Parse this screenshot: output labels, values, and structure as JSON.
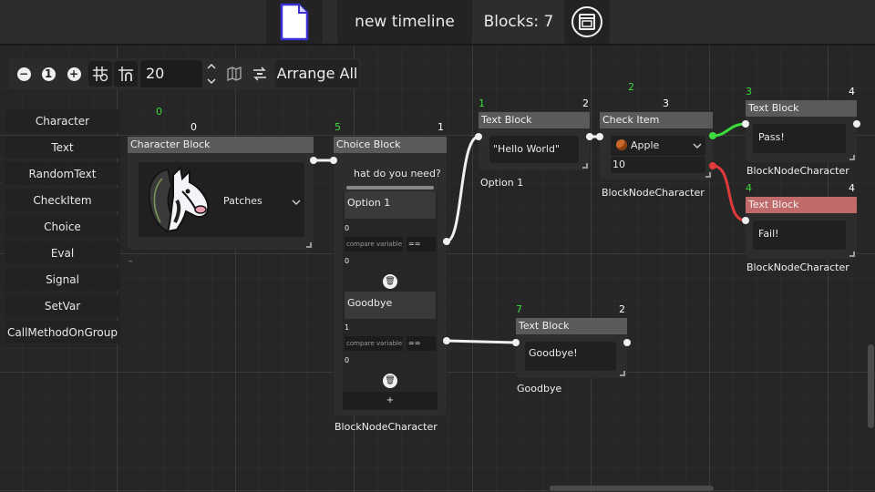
{
  "topbar": {
    "timeline_name": "new timeline",
    "blocks_count": "Blocks: 7",
    "file_icon": "document-icon",
    "menu_icon": "timeline-menu-icon"
  },
  "toolbar": {
    "zoom_out": "−",
    "zoom_reset": "1",
    "zoom_in": "+",
    "snap_value": "20",
    "arrange_all": "Arrange All"
  },
  "sidebar": {
    "items": [
      "Character",
      "Text",
      "RandomText",
      "CheckItem",
      "Choice",
      "Eval",
      "Signal",
      "SetVar",
      "CallMethodOnGroup"
    ]
  },
  "nodes": {
    "character": {
      "index": "0",
      "title": "Character Block",
      "character_name": "Patches"
    },
    "choice": {
      "index": "5",
      "out_count": "1",
      "title": "Choice Block",
      "prompt": "hat do you need?",
      "option1": {
        "label": "Option 1",
        "value": "0",
        "compare_placeholder": "compare variable",
        "operator": "==",
        "compare_value": "0"
      },
      "option2": {
        "label": "Goodbye",
        "value": "1",
        "compare_placeholder": "compare variable",
        "operator": "==",
        "compare_value": "0"
      },
      "add": "+",
      "footer": "BlockNodeCharacter"
    },
    "text1": {
      "index": "1",
      "out_count": "2",
      "title": "Text Block",
      "text": "\"Hello World\"",
      "footer": "Option 1"
    },
    "check": {
      "index": "2",
      "out_count": "3",
      "title": "Check Item",
      "item": "Apple",
      "quantity": "10",
      "footer": "BlockNodeCharacter"
    },
    "pass": {
      "index": "3",
      "out_count": "4",
      "title": "Text Block",
      "text": "Pass!",
      "footer": "BlockNodeCharacter"
    },
    "fail": {
      "index": "4",
      "out_count": "4",
      "title": "Text Block",
      "text": "Fail!",
      "footer": "BlockNodeCharacter"
    },
    "goodbye": {
      "index": "7",
      "out_count": "2",
      "title": "Text Block",
      "text": "Goodbye!",
      "footer": "Goodbye"
    }
  },
  "colors": {
    "connection_true": "#3bdc3b",
    "connection_false": "#e03a3a",
    "index_label": "#3bdc3b"
  }
}
